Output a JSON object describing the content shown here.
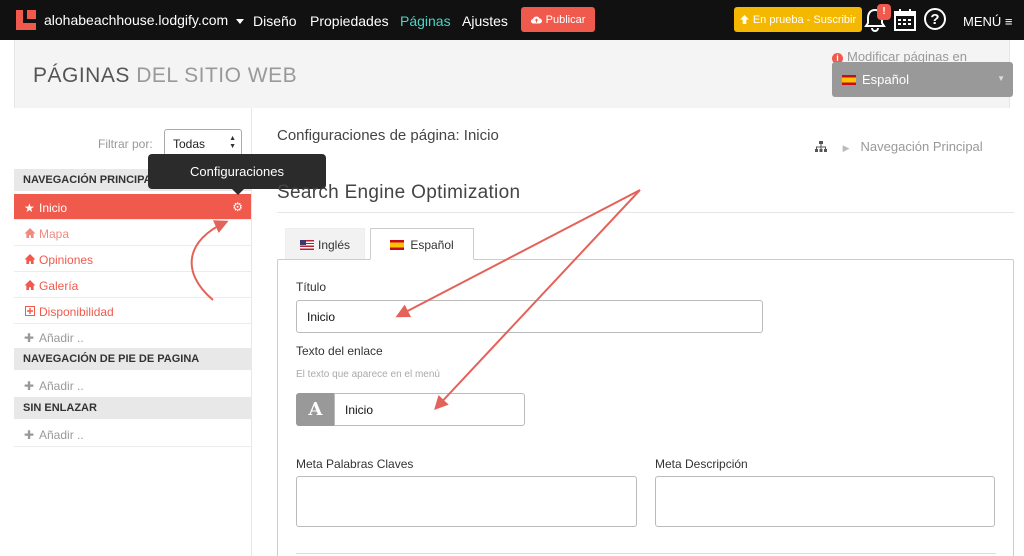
{
  "topbar": {
    "site_name": "alohabeachhouse.lodgify.com",
    "nav": [
      "Diseño",
      "Propiedades",
      "Páginas",
      "Ajustes"
    ],
    "active_nav": "Páginas",
    "publish_label": "Publicar",
    "trial_label": "En prueba - Suscribir",
    "notification_badge": "!",
    "help_symbol": "?",
    "menu_label": "MENÚ ≡",
    "icons": [
      "logo",
      "cloud-upload-icon",
      "arrow-up-icon",
      "bell-icon",
      "calendar-icon",
      "help-icon",
      "menu-icon"
    ]
  },
  "header": {
    "title_strong": "PÁGINAS",
    "title_light": "DEL SITIO WEB",
    "modify_label": "Modificar páginas en",
    "language": "Español"
  },
  "sidebar": {
    "filter_label": "Filtrar por:",
    "filter_value": "Todas",
    "sections": [
      {
        "title": "NAVEGACIÓN PRINCIPAL",
        "items": [
          {
            "label": "Inicio",
            "icon": "star-icon",
            "active": true
          },
          {
            "label": "Mapa",
            "icon": "home-icon"
          },
          {
            "label": "Opiniones",
            "icon": "home-icon"
          },
          {
            "label": "Galería",
            "icon": "home-icon"
          },
          {
            "label": "Disponibilidad",
            "icon": "plus-square-icon"
          }
        ],
        "add_label": "Añadir .."
      },
      {
        "title": "NAVEGACIÓN DE PIE DE PAGINA",
        "items": [],
        "add_label": "Añadir .."
      },
      {
        "title": "SIN ENLAZAR",
        "items": [],
        "add_label": "Añadir .."
      }
    ]
  },
  "tooltip": {
    "text": "Configuraciones"
  },
  "main": {
    "config_title": "Configuraciones de página: Inicio",
    "breadcrumb": "Navegación Principal",
    "seo_title": "Search Engine Optimization",
    "tabs": [
      {
        "label": "Inglés",
        "flag": "us"
      },
      {
        "label": "Español",
        "flag": "es",
        "active": true
      }
    ],
    "fields": {
      "title_label": "Título",
      "title_value": "Inicio",
      "link_text_label": "Texto del enlace",
      "link_text_hint": "El texto que aparece en el menú",
      "link_text_addon": "A",
      "link_text_value": "Inicio",
      "meta_keywords_label": "Meta Palabras Claves",
      "meta_description_label": "Meta Descripción"
    }
  },
  "colors": {
    "brand_red": "#ef5a4c",
    "trial_yellow": "#f5b800",
    "active_nav": "#4fd1c5",
    "topbar": "#111111"
  }
}
